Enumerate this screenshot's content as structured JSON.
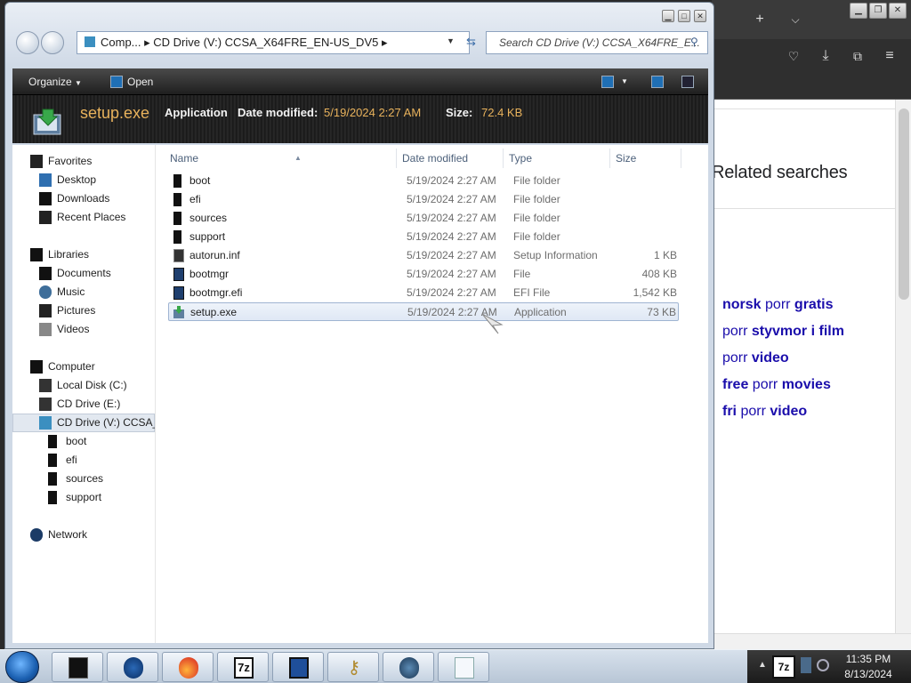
{
  "explorer": {
    "address": "Comp... ▸ CD Drive (V:) CCSA_X64FRE_EN-US_DV5 ▸",
    "search_placeholder": "Search CD Drive (V:) CCSA_X64FRE_E...",
    "toolbar": {
      "organize": "Organize",
      "open": "Open"
    },
    "details": {
      "name": "setup.exe",
      "type": "Application",
      "date_label": "Date modified:",
      "date_value": "5/19/2024 2:27 AM",
      "size_label": "Size:",
      "size_value": "72.4 KB"
    },
    "nav": {
      "favorites": "Favorites",
      "desktop": "Desktop",
      "downloads": "Downloads",
      "recent": "Recent Places",
      "libraries": "Libraries",
      "documents": "Documents",
      "music": "Music",
      "pictures": "Pictures",
      "videos": "Videos",
      "computer": "Computer",
      "local_disk": "Local Disk (C:)",
      "cd_e": "CD Drive (E:)",
      "cd_v": "CD Drive (V:) CCSA_",
      "boot": "boot",
      "efi": "efi",
      "sources": "sources",
      "support": "support",
      "network": "Network"
    },
    "columns": {
      "name": "Name",
      "date": "Date modified",
      "type": "Type",
      "size": "Size"
    },
    "files": [
      {
        "name": "boot",
        "date": "5/19/2024 2:27 AM",
        "type": "File folder",
        "size": ""
      },
      {
        "name": "efi",
        "date": "5/19/2024 2:27 AM",
        "type": "File folder",
        "size": ""
      },
      {
        "name": "sources",
        "date": "5/19/2024 2:27 AM",
        "type": "File folder",
        "size": ""
      },
      {
        "name": "support",
        "date": "5/19/2024 2:27 AM",
        "type": "File folder",
        "size": ""
      },
      {
        "name": "autorun.inf",
        "date": "5/19/2024 2:27 AM",
        "type": "Setup Information",
        "size": "1 KB"
      },
      {
        "name": "bootmgr",
        "date": "5/19/2024 2:27 AM",
        "type": "File",
        "size": "408 KB"
      },
      {
        "name": "bootmgr.efi",
        "date": "5/19/2024 2:27 AM",
        "type": "EFI File",
        "size": "1,542 KB"
      },
      {
        "name": "setup.exe",
        "date": "5/19/2024 2:27 AM",
        "type": "Application",
        "size": "73 KB"
      }
    ]
  },
  "browser": {
    "related_title": "Related searches",
    "related": [
      {
        "a": "norsk",
        "b": " porr ",
        "c": "gratis"
      },
      {
        "a": "",
        "b": "porr ",
        "c": "styvmor i film"
      },
      {
        "a": "",
        "b": "porr ",
        "c": "video"
      },
      {
        "a": "free",
        "b": " porr ",
        "c": "movies"
      },
      {
        "a": "fri",
        "b": " porr ",
        "c": "video"
      }
    ]
  },
  "taskbar": {
    "time": "11:35 PM",
    "date": "8/13/2024"
  }
}
